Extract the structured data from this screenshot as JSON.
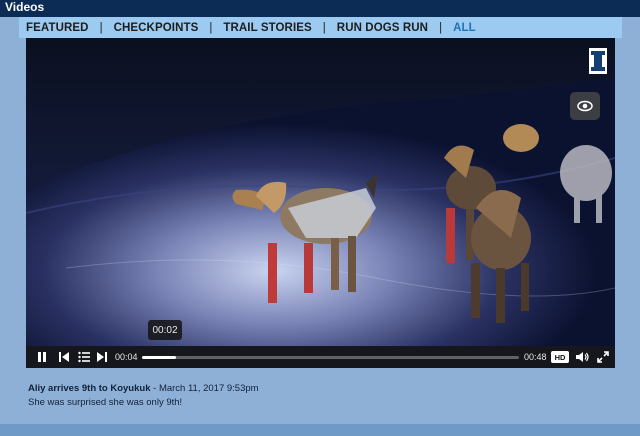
{
  "header": {
    "title": "Videos"
  },
  "nav": {
    "items": [
      {
        "label": "FEATURED"
      },
      {
        "label": "CHECKPOINTS"
      },
      {
        "label": "TRAIL STORIES"
      },
      {
        "label": "RUN DOGS RUN"
      },
      {
        "label": "ALL"
      }
    ],
    "separator": "|",
    "active": "ALL"
  },
  "player": {
    "hover_time": "00:02",
    "current_time": "00:04",
    "duration": "00:48",
    "progress": 0.09,
    "quality": "HD",
    "icons": [
      "logo-badge-icon",
      "visibility-icon",
      "pause-icon",
      "skip-back-icon",
      "playlist-icon",
      "skip-forward-icon",
      "volume-icon",
      "fullscreen-icon"
    ]
  },
  "caption": {
    "title": "Aliy arrives 9th to Koyukuk",
    "separator": " - ",
    "date": "March 11, 2017 9:53pm",
    "description": "She was surprised she was only 9th!"
  },
  "colors": {
    "background": "#8fb0d6",
    "top_bar": "#0d2c55",
    "nav_bar": "#9dcaf0",
    "nav_active": "#1e74b7",
    "controls": "#15171c"
  }
}
